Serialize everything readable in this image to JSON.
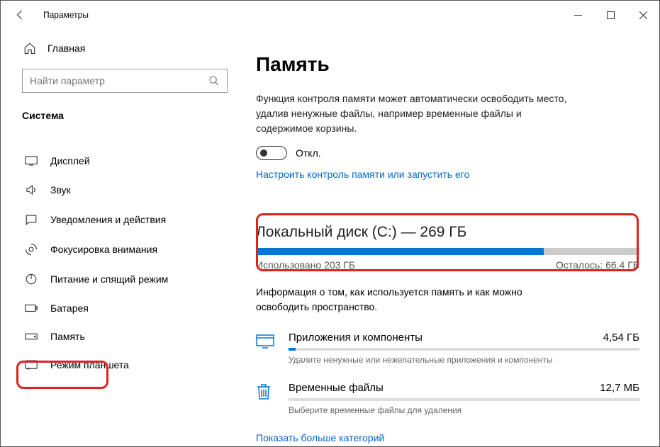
{
  "window": {
    "title": "Параметры"
  },
  "sidebar": {
    "home": "Главная",
    "search_placeholder": "Найти параметр",
    "section": "Система",
    "items": [
      {
        "label": "Дисплей"
      },
      {
        "label": "Звук"
      },
      {
        "label": "Уведомления и действия"
      },
      {
        "label": "Фокусировка внимания"
      },
      {
        "label": "Питание и спящий режим"
      },
      {
        "label": "Батарея"
      },
      {
        "label": "Память"
      },
      {
        "label": "Режим планшета"
      }
    ]
  },
  "main": {
    "title": "Память",
    "desc": "Функция контроля памяти может автоматически освободить место, удалив ненужные файлы, например временные файлы и содержимое корзины.",
    "toggle_label": "Откл.",
    "config_link": "Настроить контроль памяти или запустить его",
    "disk": {
      "title": "Локальный диск (C:) — 269 ГБ",
      "used_label": "Использовано 203 ГБ",
      "free_label": "Осталось: 66,4 ГБ",
      "fill_pct": 75
    },
    "info": "Информация о том, как используется память и как можно освободить пространство.",
    "categories": [
      {
        "name": "Приложения и компоненты",
        "size": "4,54 ГБ",
        "hint": "Удалите ненужные или нежелательные приложения и компоненты",
        "fill_pct": 2
      },
      {
        "name": "Временные файлы",
        "size": "12,7 МБ",
        "hint": "Выберите временные файлы для удаления",
        "fill_pct": 0
      }
    ],
    "more_link": "Показать больше категорий"
  }
}
